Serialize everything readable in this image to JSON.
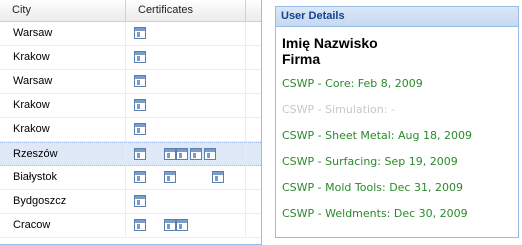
{
  "grid": {
    "columns": {
      "city": "City",
      "certificates": "Certificates"
    },
    "rows": [
      {
        "city": "Warsaw",
        "icons": 1,
        "selected": false
      },
      {
        "city": "Krakow",
        "icons": 1,
        "selected": false
      },
      {
        "city": "Warsaw",
        "icons": 1,
        "selected": false
      },
      {
        "city": "Krakow",
        "icons": 1,
        "selected": false
      },
      {
        "city": "Krakow",
        "icons": 1,
        "selected": false
      },
      {
        "city": "Rzeszów",
        "icons": 5,
        "selected": true
      },
      {
        "city": "Białystok",
        "icons": 3,
        "selected": false
      },
      {
        "city": "Bydgoszcz",
        "icons": 1,
        "selected": false
      },
      {
        "city": "Cracow",
        "icons": 3,
        "selected": false
      }
    ]
  },
  "details": {
    "title": "User Details",
    "name": "Imię Nazwisko",
    "company": "Firma",
    "certificates": [
      {
        "text": "CSWP - Core: Feb 8, 2009",
        "status": "ok"
      },
      {
        "text": "CSWP - Simulation: -",
        "status": "missing"
      },
      {
        "text": "CSWP - Sheet Metal: Aug 18, 2009",
        "status": "ok"
      },
      {
        "text": "CSWP - Surfacing: Sep 19, 2009",
        "status": "ok"
      },
      {
        "text": "CSWP - Mold Tools: Dec 31, 2009",
        "status": "ok"
      },
      {
        "text": "CSWP - Weldments: Dec 30, 2009",
        "status": "ok"
      }
    ],
    "colors": {
      "ok": "#2a8a2a",
      "missing": "#c8c8c8",
      "header": "#15428b"
    }
  }
}
